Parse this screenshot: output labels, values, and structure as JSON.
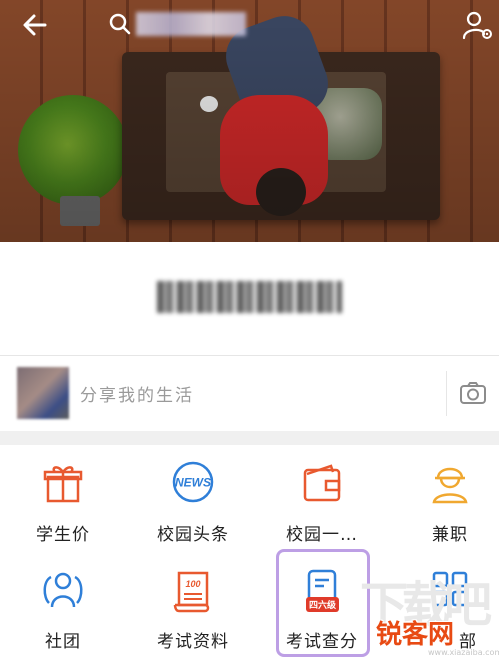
{
  "header": {
    "search_placeholder": "",
    "icons": [
      "back-arrow-icon",
      "search-icon",
      "user-settings-icon"
    ]
  },
  "share": {
    "placeholder": "分享我的生活",
    "camera_icon": "camera-icon"
  },
  "grid": {
    "items": [
      {
        "label": "学生价",
        "icon": "gift-icon",
        "color": "#e8592f"
      },
      {
        "label": "校园头条",
        "icon": "news-icon",
        "color": "#2f7fd8",
        "icon_text": "NEWS"
      },
      {
        "label": "校园一…",
        "icon": "wallet-icon",
        "color": "#e8592f"
      },
      {
        "label": "兼职",
        "icon": "worker-icon",
        "color": "#f0a830"
      },
      {
        "label": "社团",
        "icon": "club-icon",
        "color": "#2f7fd8"
      },
      {
        "label": "考试资料",
        "icon": "scroll-icon",
        "color": "#e8592f",
        "icon_text": "100"
      },
      {
        "label": "考试查分",
        "icon": "exam-score-icon",
        "color": "#2f7fd8",
        "badge": "四六级"
      },
      {
        "label": "部",
        "icon": "all-grid-icon",
        "color": "#2f7fd8"
      }
    ]
  },
  "watermark": {
    "brand": "锐客网",
    "url": "www.xiazaiba.com",
    "background_text": "下载吧"
  }
}
